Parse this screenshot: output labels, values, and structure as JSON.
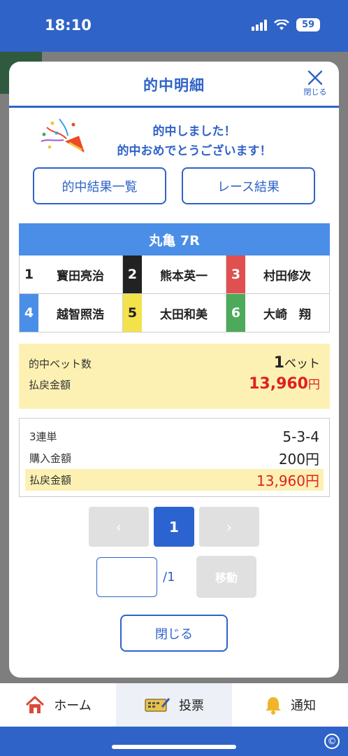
{
  "status": {
    "time": "18:10",
    "battery": "59"
  },
  "modal": {
    "title": "的中明細",
    "close_label": "閉じる",
    "congrats_line1": "的中しました！",
    "congrats_line2": "的中おめでとうございます！",
    "btn_hit_list": "的中結果一覧",
    "btn_race_result": "レース結果"
  },
  "race": {
    "header": "丸亀 7R",
    "racers": [
      {
        "num": "1",
        "name": "寳田亮治",
        "color": "#ffffff",
        "text_color": "#222222"
      },
      {
        "num": "2",
        "name": "熊本英一",
        "color": "#222222",
        "text_color": "#ffffff"
      },
      {
        "num": "3",
        "name": "村田修次",
        "color": "#e05050",
        "text_color": "#ffffff"
      },
      {
        "num": "4",
        "name": "越智照浩",
        "color": "#4a8ee8",
        "text_color": "#ffffff"
      },
      {
        "num": "5",
        "name": "太田和美",
        "color": "#f3e24a",
        "text_color": "#222222"
      },
      {
        "num": "6",
        "name": "大崎　翔",
        "color": "#4caa5a",
        "text_color": "#ffffff"
      }
    ]
  },
  "summary": {
    "bets_label": "的中ベット数",
    "bets_value": "1",
    "bets_unit": "ベット",
    "payout_label": "払戻金額",
    "payout_value": "13,960",
    "payout_unit": "円"
  },
  "detail": {
    "type_label": "3連単",
    "type_value": "5-3-4",
    "purchase_label": "購入金額",
    "purchase_value": "200円",
    "payout_label": "払戻金額",
    "payout_value": "13,960円"
  },
  "pager": {
    "prev": "‹",
    "current": "1",
    "next": "›",
    "total": "/1",
    "move_label": "移動"
  },
  "close_button": "閉じる",
  "tabbar": {
    "home": "ホーム",
    "vote": "投票",
    "notify": "通知"
  }
}
